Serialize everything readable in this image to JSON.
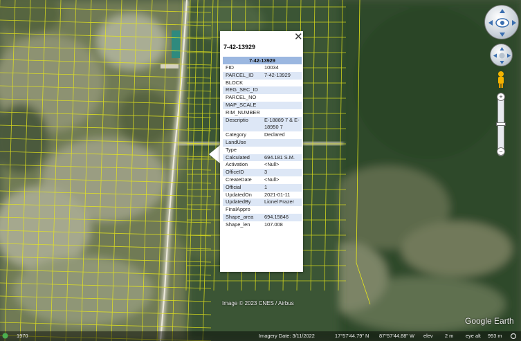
{
  "popup": {
    "title": "7-42-13929",
    "table_header": "7-42-13929",
    "close_glyph": "✕",
    "rows": [
      {
        "k": "FID",
        "v": "10034"
      },
      {
        "k": "PARCEL_ID",
        "v": "7-42-13929"
      },
      {
        "k": "BLOCK",
        "v": ""
      },
      {
        "k": "REG_SEC_ID",
        "v": ""
      },
      {
        "k": "PARCEL_NO",
        "v": ""
      },
      {
        "k": "MAP_SCALE",
        "v": ""
      },
      {
        "k": "RIM_NUMBER",
        "v": ""
      },
      {
        "k": "Descriptio",
        "v": "E-18889 7 & E-18950 7"
      },
      {
        "k": "Category",
        "v": "Declared"
      },
      {
        "k": "LandUse",
        "v": ""
      },
      {
        "k": "Type",
        "v": ""
      },
      {
        "k": "Calculated",
        "v": "694.181 S.M."
      },
      {
        "k": "Activation",
        "v": "<Null>"
      },
      {
        "k": "OfficeID",
        "v": "3"
      },
      {
        "k": "CreateDate",
        "v": "<Null>"
      },
      {
        "k": "Official",
        "v": "1"
      },
      {
        "k": "UpdatedOn",
        "v": "2021-01-11"
      },
      {
        "k": "UpdatedBy",
        "v": "Lionel Frazer"
      },
      {
        "k": "FinalAppro",
        "v": ""
      },
      {
        "k": "Shape_area",
        "v": "694.15846"
      },
      {
        "k": "Shape_len",
        "v": "107.008"
      }
    ]
  },
  "map": {
    "credit": "Image © 2023 CNES / Airbus",
    "logo": "Google Earth",
    "parcel_line_color": "#e8e81a"
  },
  "statusbar": {
    "history_year": "1970",
    "imagery_date": "Imagery Date: 3/11/2022",
    "lat": "17°57'44.79\" N",
    "lon": "87°57'44.88\" W",
    "elev_label": "elev",
    "elev_value": "2 m",
    "eye_alt_label": "eye alt",
    "eye_alt_value": "993 m"
  },
  "nav": {
    "look_icon": "eye-icon",
    "move_icon": "hand-icon",
    "pegman_icon": "pegman-icon",
    "zoom_in": "+",
    "zoom_out": "−"
  }
}
